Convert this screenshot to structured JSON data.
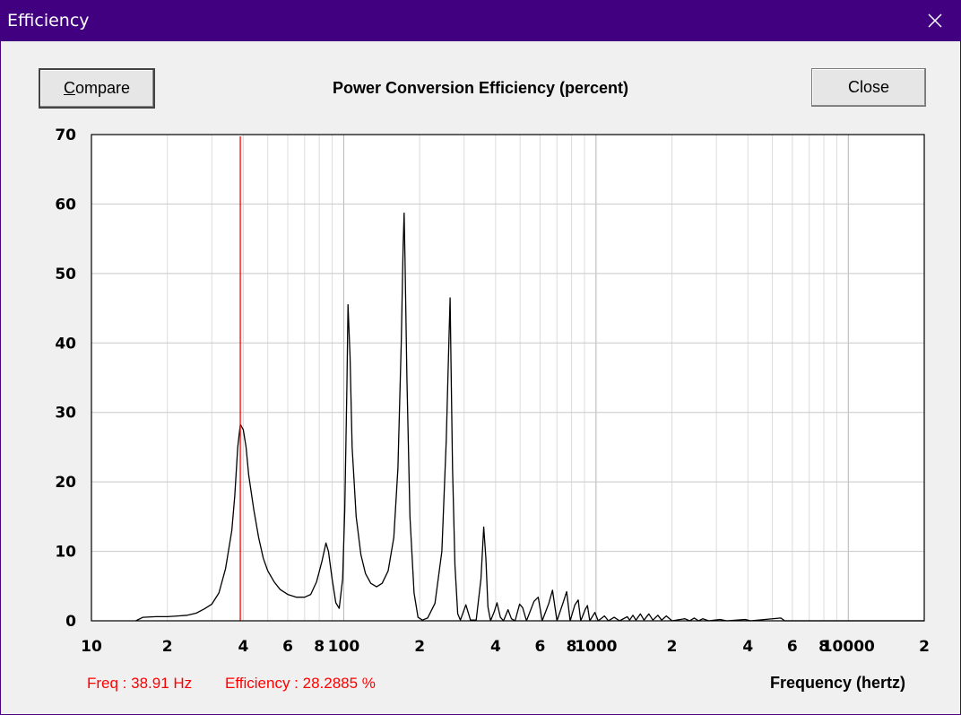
{
  "window": {
    "title": "Efficiency"
  },
  "buttons": {
    "compare": "Compare",
    "close": "Close"
  },
  "readout": {
    "freq": "Freq : 38.91 Hz",
    "efficiency": "Efficiency : 28.2885 %"
  },
  "colors": {
    "titlebar": "#400080",
    "curve": "#000000",
    "cursor": "#ff0000",
    "grid": "#c8c8c8"
  },
  "chart_data": {
    "type": "line",
    "title": "Power Conversion Efficiency (percent)",
    "xlabel": "Frequency (hertz)",
    "ylabel": "",
    "xscale": "log",
    "xlim": [
      10,
      20000
    ],
    "ylim": [
      0,
      70
    ],
    "grid": true,
    "yticks": [
      "0",
      "10",
      "20",
      "30",
      "40",
      "50",
      "60",
      "70"
    ],
    "yticks_values": [
      0,
      10,
      20,
      30,
      40,
      50,
      60,
      70
    ],
    "xticks": [
      {
        "value": 10,
        "label": "10"
      },
      {
        "value": 20,
        "label": "2"
      },
      {
        "value": 40,
        "label": "4"
      },
      {
        "value": 60,
        "label": "6"
      },
      {
        "value": 80,
        "label": "8"
      },
      {
        "value": 100,
        "label": "100"
      },
      {
        "value": 200,
        "label": "2"
      },
      {
        "value": 400,
        "label": "4"
      },
      {
        "value": 600,
        "label": "6"
      },
      {
        "value": 800,
        "label": "8"
      },
      {
        "value": 1000,
        "label": "1000"
      },
      {
        "value": 2000,
        "label": "2"
      },
      {
        "value": 4000,
        "label": "4"
      },
      {
        "value": 6000,
        "label": "6"
      },
      {
        "value": 8000,
        "label": "8"
      },
      {
        "value": 10000,
        "label": "10000"
      },
      {
        "value": 20000,
        "label": "2"
      }
    ],
    "cursor": {
      "x": 38.91,
      "y": 28.2885
    },
    "series": [
      {
        "values": [
          [
            15,
            0
          ],
          [
            16,
            0.5
          ],
          [
            18,
            0.6
          ],
          [
            20,
            0.6
          ],
          [
            22,
            0.7
          ],
          [
            24,
            0.8
          ],
          [
            26,
            1.1
          ],
          [
            28,
            1.7
          ],
          [
            30,
            2.4
          ],
          [
            32,
            4
          ],
          [
            34,
            7.5
          ],
          [
            36,
            13
          ],
          [
            37,
            18
          ],
          [
            38,
            25
          ],
          [
            38.91,
            28.2885
          ],
          [
            40,
            27.5
          ],
          [
            41,
            25
          ],
          [
            42,
            21
          ],
          [
            44,
            16
          ],
          [
            46,
            12
          ],
          [
            48,
            9
          ],
          [
            50,
            7.2
          ],
          [
            53,
            5.6
          ],
          [
            56,
            4.5
          ],
          [
            60,
            3.8
          ],
          [
            65,
            3.4
          ],
          [
            70,
            3.4
          ],
          [
            74,
            3.8
          ],
          [
            78,
            5.6
          ],
          [
            82,
            8.6
          ],
          [
            85,
            11.2
          ],
          [
            87,
            10
          ],
          [
            90,
            6
          ],
          [
            93,
            2.6
          ],
          [
            96,
            1.8
          ],
          [
            99,
            6
          ],
          [
            101,
            16
          ],
          [
            103,
            34
          ],
          [
            104,
            45.5
          ],
          [
            106,
            38
          ],
          [
            108,
            25
          ],
          [
            112,
            15
          ],
          [
            117,
            9.5
          ],
          [
            122,
            6.8
          ],
          [
            128,
            5.4
          ],
          [
            135,
            4.9
          ],
          [
            142,
            5.4
          ],
          [
            150,
            7.2
          ],
          [
            158,
            12
          ],
          [
            164,
            22
          ],
          [
            169,
            40
          ],
          [
            172,
            54
          ],
          [
            173.5,
            58.7
          ],
          [
            175,
            52
          ],
          [
            178,
            35
          ],
          [
            183,
            15
          ],
          [
            190,
            4
          ],
          [
            197,
            0.5
          ],
          [
            205,
            0.1
          ],
          [
            215,
            0.4
          ],
          [
            230,
            2.5
          ],
          [
            245,
            10
          ],
          [
            255,
            26
          ],
          [
            261,
            40
          ],
          [
            264,
            46.5
          ],
          [
            266,
            38
          ],
          [
            270,
            22
          ],
          [
            276,
            8
          ],
          [
            283,
            1
          ],
          [
            290,
            0.1
          ],
          [
            305,
            2.3
          ],
          [
            318,
            0.1
          ],
          [
            335,
            0.1
          ],
          [
            350,
            6
          ],
          [
            359,
            13.5
          ],
          [
            366,
            9
          ],
          [
            373,
            2
          ],
          [
            382,
            0
          ],
          [
            395,
            1.3
          ],
          [
            405,
            2.6
          ],
          [
            418,
            0.5
          ],
          [
            430,
            0
          ],
          [
            448,
            1.6
          ],
          [
            462,
            0.3
          ],
          [
            478,
            0
          ],
          [
            498,
            2.4
          ],
          [
            512,
            1.9
          ],
          [
            530,
            0
          ],
          [
            568,
            2.8
          ],
          [
            590,
            3.4
          ],
          [
            612,
            0
          ],
          [
            650,
            2.5
          ],
          [
            672,
            4.4
          ],
          [
            700,
            0
          ],
          [
            740,
            2.6
          ],
          [
            765,
            4.2
          ],
          [
            790,
            0
          ],
          [
            825,
            2.3
          ],
          [
            850,
            3
          ],
          [
            870,
            0
          ],
          [
            905,
            1.6
          ],
          [
            925,
            2.2
          ],
          [
            945,
            0
          ],
          [
            990,
            1.2
          ],
          [
            1020,
            0
          ],
          [
            1080,
            0.7
          ],
          [
            1120,
            0
          ],
          [
            1180,
            0.5
          ],
          [
            1240,
            0
          ],
          [
            1330,
            0.6
          ],
          [
            1360,
            0.1
          ],
          [
            1400,
            0.8
          ],
          [
            1440,
            0.1
          ],
          [
            1500,
            1
          ],
          [
            1550,
            0.1
          ],
          [
            1620,
            1
          ],
          [
            1680,
            0.1
          ],
          [
            1760,
            0.8
          ],
          [
            1820,
            0.1
          ],
          [
            1900,
            0.7
          ],
          [
            2000,
            0
          ],
          [
            2250,
            0.3
          ],
          [
            2350,
            0
          ],
          [
            2450,
            0.4
          ],
          [
            2550,
            0
          ],
          [
            2650,
            0.3
          ],
          [
            2800,
            0
          ],
          [
            3100,
            0.2
          ],
          [
            3300,
            0
          ],
          [
            3900,
            0.2
          ],
          [
            4100,
            0
          ],
          [
            5400,
            0.4
          ],
          [
            5600,
            0
          ],
          [
            20000,
            0
          ]
        ]
      }
    ]
  }
}
